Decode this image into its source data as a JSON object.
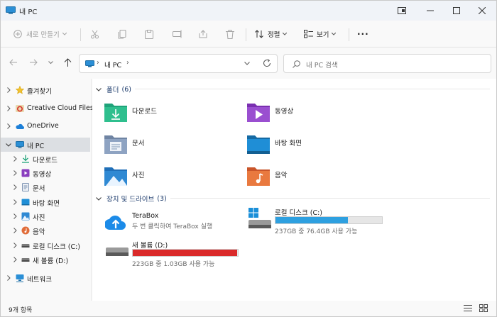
{
  "window": {
    "title": "내 PC"
  },
  "toolbar": {
    "new_label": "새로 만들기",
    "sort_label": "정렬",
    "view_label": "보기",
    "more_label": "···"
  },
  "address": {
    "path_segment": "내 PC",
    "chevron": "›"
  },
  "search": {
    "placeholder": "내 PC 검색"
  },
  "sidebar": {
    "items": [
      {
        "label": "즐겨찾기",
        "icon": "star-icon"
      },
      {
        "label": "Creative Cloud Files",
        "icon": "creative-cloud-icon"
      },
      {
        "label": "OneDrive",
        "icon": "cloud-icon"
      },
      {
        "label": "내 PC",
        "icon": "computer-icon"
      },
      {
        "label": "다운로드",
        "icon": "download-icon"
      },
      {
        "label": "동영상",
        "icon": "video-icon"
      },
      {
        "label": "문서",
        "icon": "document-icon"
      },
      {
        "label": "바탕 화면",
        "icon": "desktop-icon"
      },
      {
        "label": "사진",
        "icon": "picture-icon"
      },
      {
        "label": "음악",
        "icon": "music-icon"
      },
      {
        "label": "로컬 디스크 (C:)",
        "icon": "drive-icon"
      },
      {
        "label": "새 볼륨 (D:)",
        "icon": "drive-icon"
      },
      {
        "label": "네트워크",
        "icon": "network-icon"
      }
    ]
  },
  "groups": {
    "folders_title": "폴더",
    "folders_count": "(6)",
    "drives_title": "장치 및 드라이브",
    "drives_count": "(3)"
  },
  "folders": [
    {
      "label": "다운로드",
      "color": "#1fa37a"
    },
    {
      "label": "동영상",
      "color": "#8a3fbf"
    },
    {
      "label": "문서",
      "color": "#7f95b3"
    },
    {
      "label": "바탕 화면",
      "color": "#1f8ed6"
    },
    {
      "label": "사진",
      "color": "#2f89d3"
    },
    {
      "label": "음악",
      "color": "#e06d3a"
    }
  ],
  "drives": {
    "terabox_name": "TeraBox",
    "terabox_sub": "두 번 클릭하여 TeraBox 실행",
    "c_name": "로컬 디스크 (C:)",
    "c_sub": "237GB 중 76.4GB 사용 가능",
    "c_used_fraction": 0.678,
    "c_color": "#2ea0e0",
    "d_name": "새 볼륨 (D:)",
    "d_sub": "223GB 중 1.03GB 사용 가능",
    "d_used_fraction": 0.995,
    "d_color": "#da2a2a"
  },
  "status": {
    "item_count": "9개 항목"
  }
}
